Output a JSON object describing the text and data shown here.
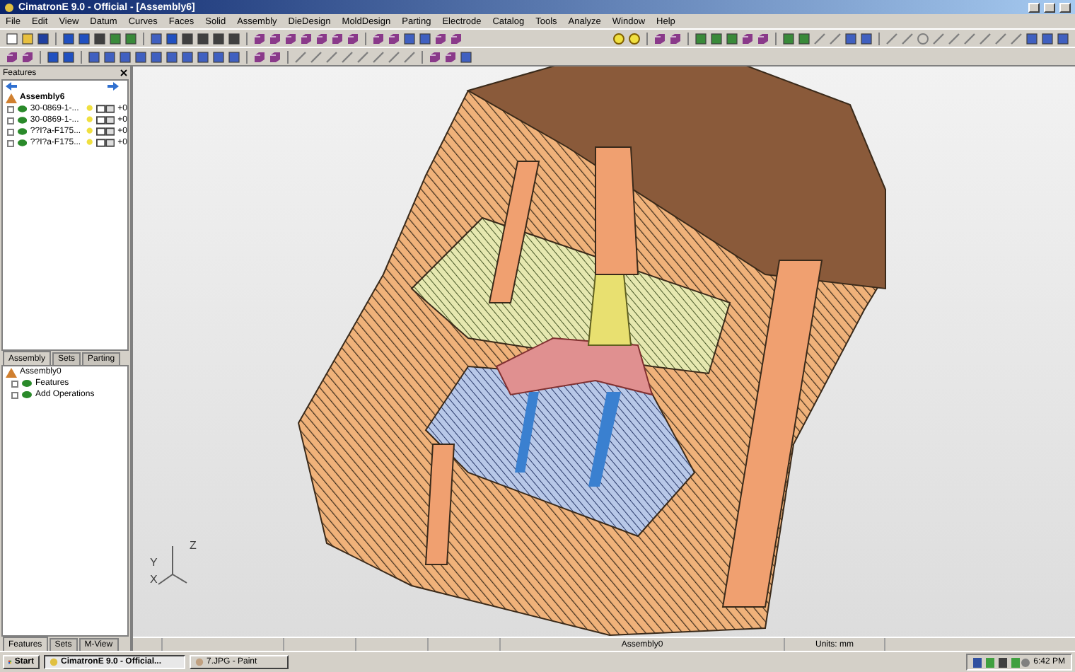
{
  "window": {
    "title": "CimatronE 9.0 - Official - [Assembly6]"
  },
  "menu": [
    "File",
    "Edit",
    "View",
    "Datum",
    "Curves",
    "Faces",
    "Solid",
    "Assembly",
    "DieDesign",
    "MoldDesign",
    "Parting",
    "Electrode",
    "Catalog",
    "Tools",
    "Analyze",
    "Window",
    "Help"
  ],
  "feature_panel": {
    "title": "Features",
    "tree": {
      "label": "Assembly6",
      "children": [
        {
          "label": "30-0869-1-...",
          "status": "+0"
        },
        {
          "label": "30-0869-1-...",
          "status": "+0"
        },
        {
          "label": "??I?a-F175...",
          "status": "+0"
        },
        {
          "label": "??I?a-F175...",
          "status": "+0"
        }
      ]
    }
  },
  "mid_tabs": [
    {
      "label": "Assembly",
      "selected": true
    },
    {
      "label": "Sets",
      "selected": false
    },
    {
      "label": "Parting",
      "selected": false
    }
  ],
  "operations_tree": {
    "label": "Assembly0",
    "children": [
      {
        "label": "Features",
        "expanded": false
      },
      {
        "label": "Add Operations",
        "expanded": false
      }
    ]
  },
  "bottom_tabs": [
    {
      "label": "Features",
      "selected": true
    },
    {
      "label": "Sets",
      "selected": false
    },
    {
      "label": "M-View",
      "selected": false
    }
  ],
  "viewport": {
    "axes": [
      "Z",
      "Y",
      "X"
    ]
  },
  "status_bar": {
    "model": "Assembly0",
    "units": "Units: mm"
  },
  "taskbar": {
    "start": "Start",
    "tasks": [
      {
        "label": "CimatronE 9.0 - Official...",
        "selected": true
      },
      {
        "label": "7.JPG - Paint",
        "selected": false
      }
    ],
    "clock": "6:42 PM"
  }
}
